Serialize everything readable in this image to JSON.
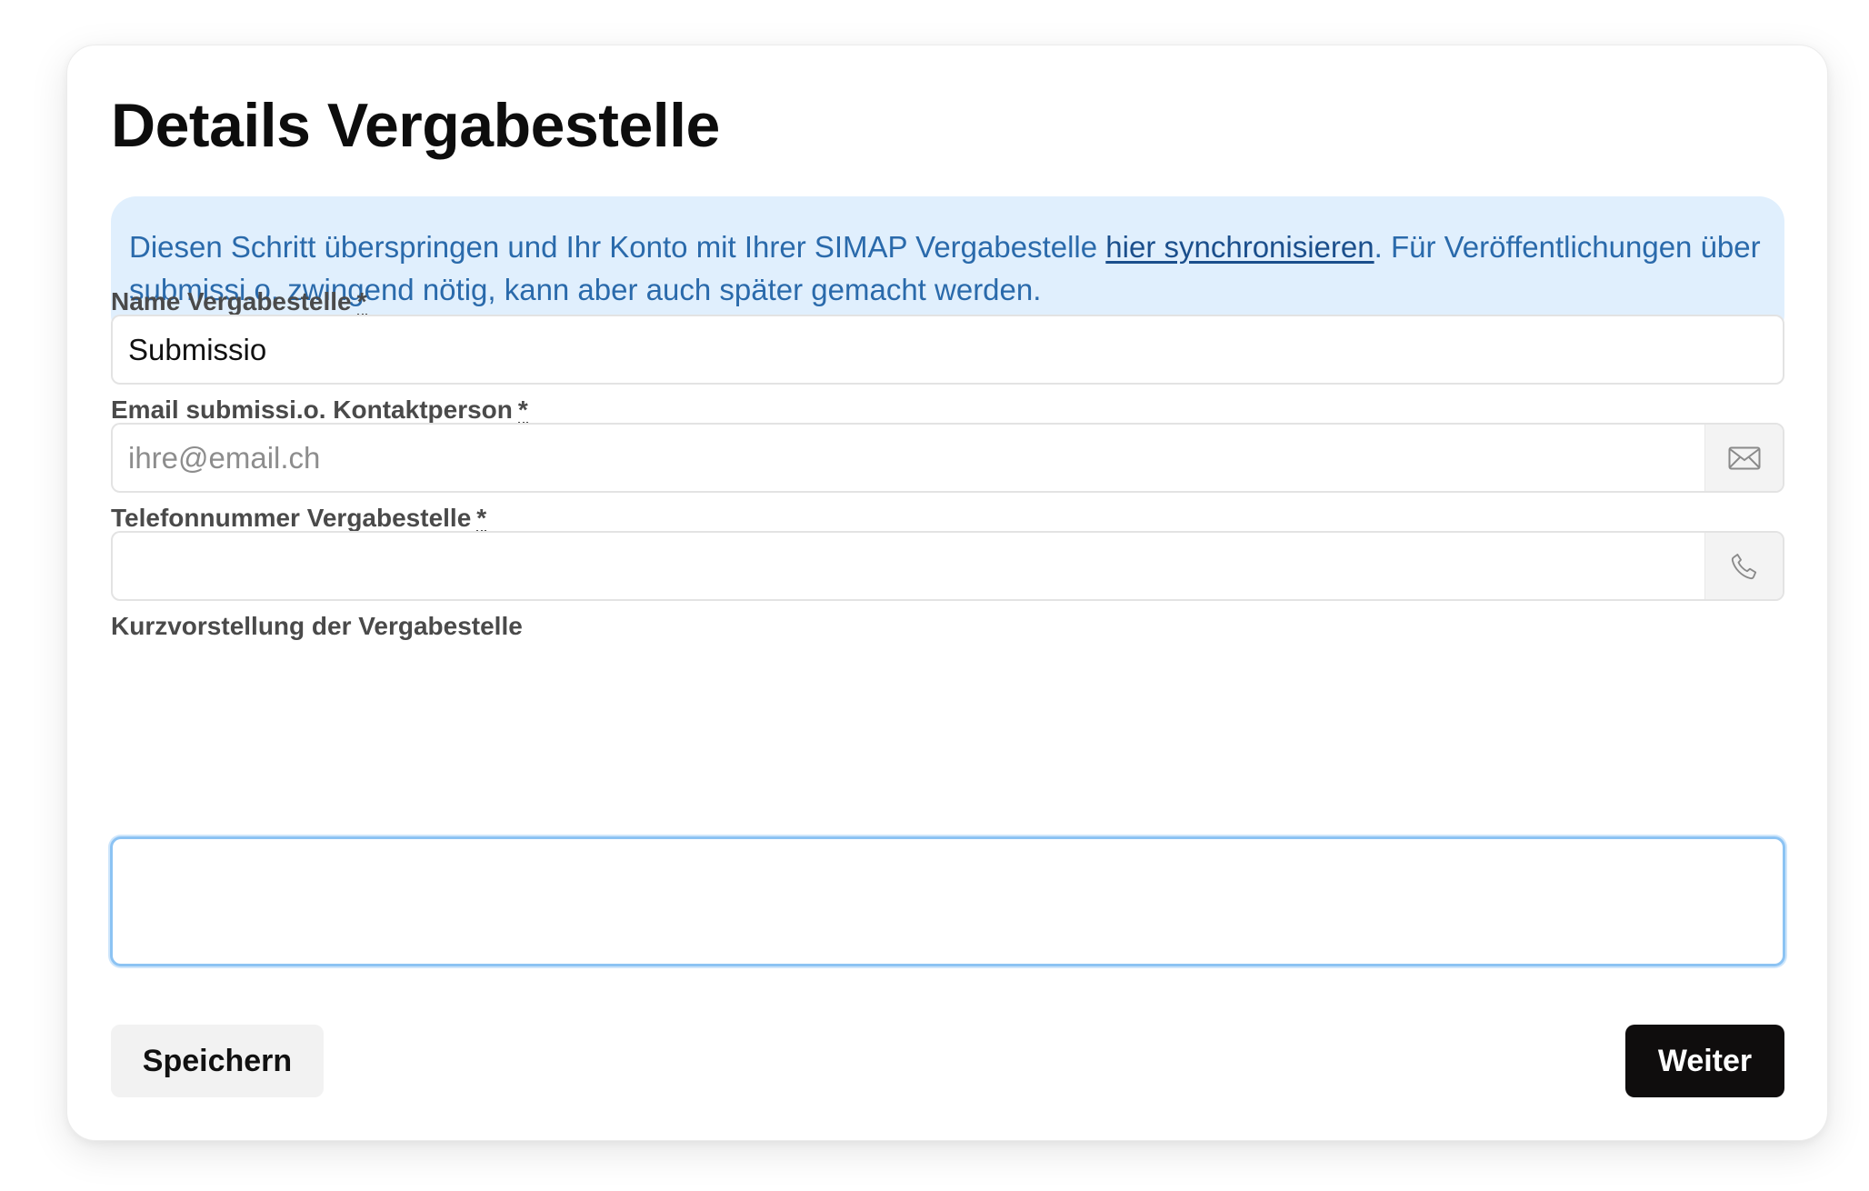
{
  "page": {
    "title": "Details Vergabestelle"
  },
  "info": {
    "text_before": "Diesen Schritt überspringen und Ihr Konto mit Ihrer SIMAP Vergabestelle ",
    "link_label": "hier synchronisieren",
    "text_after": ". Für Veröffentlichungen über submissi.o. zwingend nötig, kann aber auch später gemacht werden."
  },
  "form": {
    "name": {
      "label": "Name Vergabestelle",
      "required_mark": "*",
      "value": "Submissio"
    },
    "email": {
      "label": "Email submissi.o. Kontaktperson",
      "required_mark": "*",
      "value": "",
      "placeholder": "ihre@email.ch",
      "icon": "envelope-icon"
    },
    "phone": {
      "label": "Telefonnummer Vergabestelle",
      "required_mark": "*",
      "value": "",
      "placeholder": "",
      "icon": "phone-icon"
    },
    "description": {
      "label": "Kurzvorstellung der Vergabestelle",
      "value": ""
    }
  },
  "actions": {
    "save_label": "Speichern",
    "next_label": "Weiter"
  },
  "colors": {
    "info_background": "#e0effd",
    "info_text": "#2a6aab",
    "primary_button": "#0f0d0d",
    "secondary_button": "#f2f2f2",
    "focus_ring": "#8cc3f3"
  }
}
